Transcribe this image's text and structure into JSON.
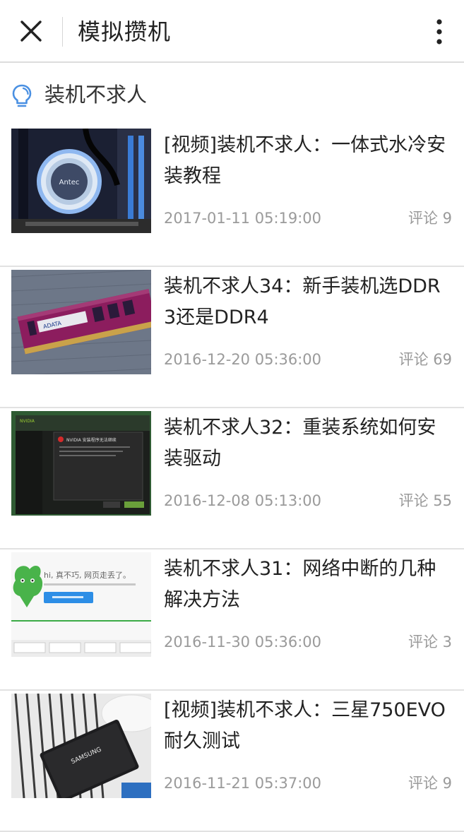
{
  "header": {
    "title": "模拟攒机",
    "close_icon": "close-icon",
    "more_icon": "more-vertical-icon"
  },
  "section": {
    "icon": "lightbulb-icon",
    "title": "装机不求人"
  },
  "articles": [
    {
      "title": "[视频]装机不求人：一体式水冷安装教程",
      "date": "2017-01-11 05:19:00",
      "comments": "评论 9",
      "thumb_text": "Antec"
    },
    {
      "title": "装机不求人34：新手装机选DDR3还是DDR4",
      "date": "2016-12-20 05:36:00",
      "comments": "评论 69",
      "thumb_text": "ADATA"
    },
    {
      "title": "装机不求人32：重装系统如何安装驱动",
      "date": "2016-12-08 05:13:00",
      "comments": "评论 55",
      "thumb_text": "NVIDIA 安装程序无法继续"
    },
    {
      "title": "装机不求人31：网络中断的几种解决方法",
      "date": "2016-11-30 05:36:00",
      "comments": "评论 3",
      "thumb_text": "hi, 真不巧, 网页走丢了。"
    },
    {
      "title": "[视频]装机不求人：三星750EVO耐久测试",
      "date": "2016-11-21 05:37:00",
      "comments": "评论 9",
      "thumb_text": "SAMSUNG"
    }
  ],
  "colors": {
    "accent": "#4a90e2",
    "text": "#222222",
    "meta": "#9a9a9a",
    "divider": "#e2e2e2"
  }
}
